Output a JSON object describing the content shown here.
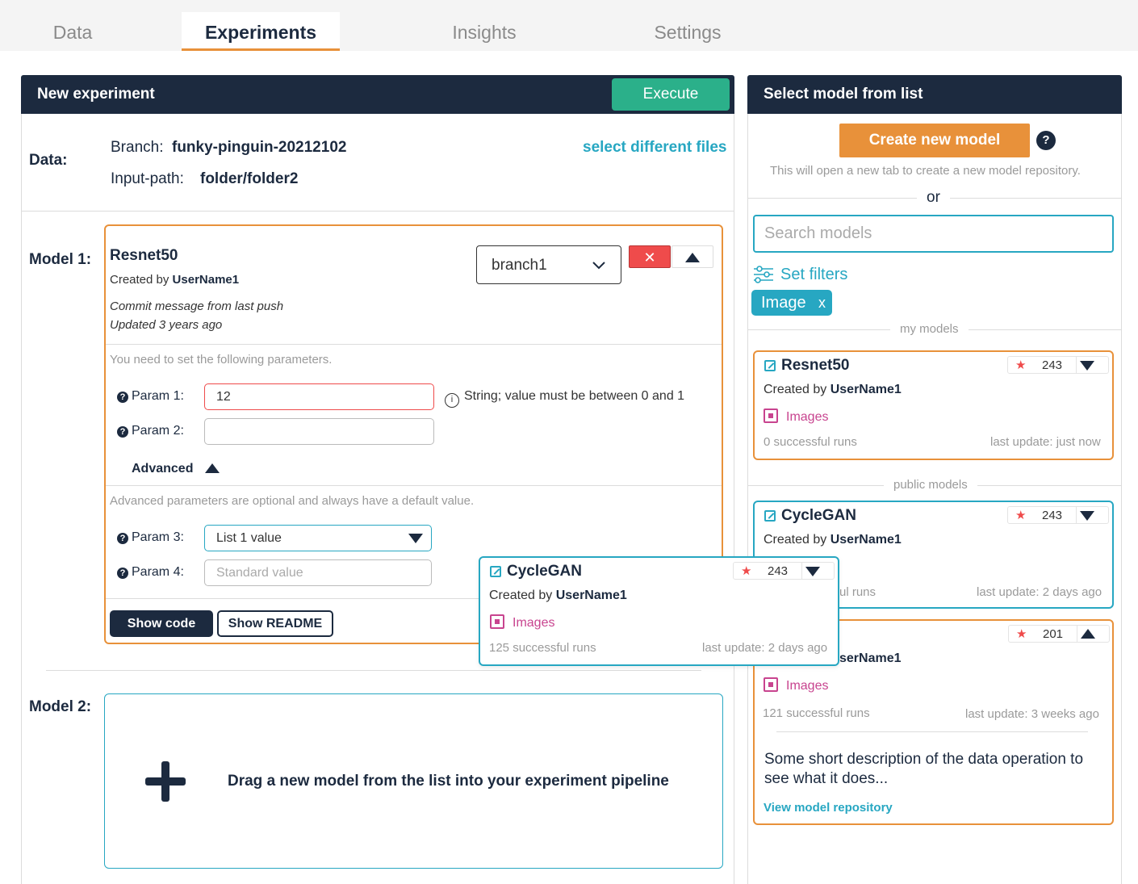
{
  "tabs": [
    {
      "label": "Data"
    },
    {
      "label": "Experiments",
      "active": true
    },
    {
      "label": "Insights"
    },
    {
      "label": "Settings"
    }
  ],
  "experiment": {
    "title": "New experiment",
    "execute_label": "Execute",
    "data_label": "Data:",
    "branch_label": "Branch:",
    "branch_value": "funky-pinguin-20212102",
    "input_path_label": "Input-path:",
    "input_path_value": "folder/folder2",
    "select_files_label": "select different files"
  },
  "model1": {
    "label": "Model 1:",
    "name": "Resnet50",
    "created_prefix": "Created by",
    "user": "UserName1",
    "commit": "Commit message from last push",
    "updated": "Updated 3 years ago",
    "branch": "branch1",
    "params_note": "You need to set the following parameters.",
    "params": [
      {
        "label": "Param 1:",
        "value": "12",
        "hint": "String; value must be between 0 and 1"
      },
      {
        "label": "Param 2:",
        "value": ""
      }
    ],
    "advanced_label": "Advanced",
    "advanced_note": "Advanced parameters are optional and always have a default value.",
    "advanced_params": [
      {
        "label": "Param 3:",
        "value": "List 1 value"
      },
      {
        "label": "Param 4:",
        "placeholder": "Standard value"
      }
    ],
    "show_code": "Show code",
    "show_readme": "Show README"
  },
  "model2": {
    "label": "Model 2:",
    "drop_text": "Drag a new model from the list into your experiment pipeline"
  },
  "model_list": {
    "title": "Select model from list",
    "create_label": "Create new model",
    "create_note": "This will open a new tab to create a new model repository.",
    "or": "or",
    "search_placeholder": "Search models",
    "filters_label": "Set filters",
    "filter_chip": "Image",
    "filter_chip_remove": "x",
    "my_models_label": "my models",
    "public_models_label": "public models",
    "cards": [
      {
        "name": "Resnet50",
        "created_prefix": "Created by",
        "user": "UserName1",
        "stars": "243",
        "tag": "Images",
        "runs": "0 successful runs",
        "update": "last update: just now"
      },
      {
        "name": "CycleGAN",
        "created_prefix": "Created by",
        "user": "UserName1",
        "stars": "243",
        "runs_partial": "ul runs",
        "update": "last update: 2 days ago"
      },
      {
        "user_partial": "serName1",
        "stars": "201",
        "tag": "Images",
        "runs": "121 successful runs",
        "update": "last update: 3 weeks ago",
        "description": "Some short description of the data operation to see what it does...",
        "repo_link": "View model repository"
      }
    ]
  },
  "drag_card": {
    "name": "CycleGAN",
    "created_prefix": "Created by",
    "user": "UserName1",
    "stars": "243",
    "tag": "Images",
    "runs": "125 successful runs",
    "update": "last update: 2 days ago"
  },
  "colors": {
    "navy": "#1c2a3f",
    "teal": "#27a7c2",
    "orange": "#e8913a",
    "green": "#2bb08a",
    "red": "#ef4b4b",
    "magenta": "#c8448f"
  }
}
